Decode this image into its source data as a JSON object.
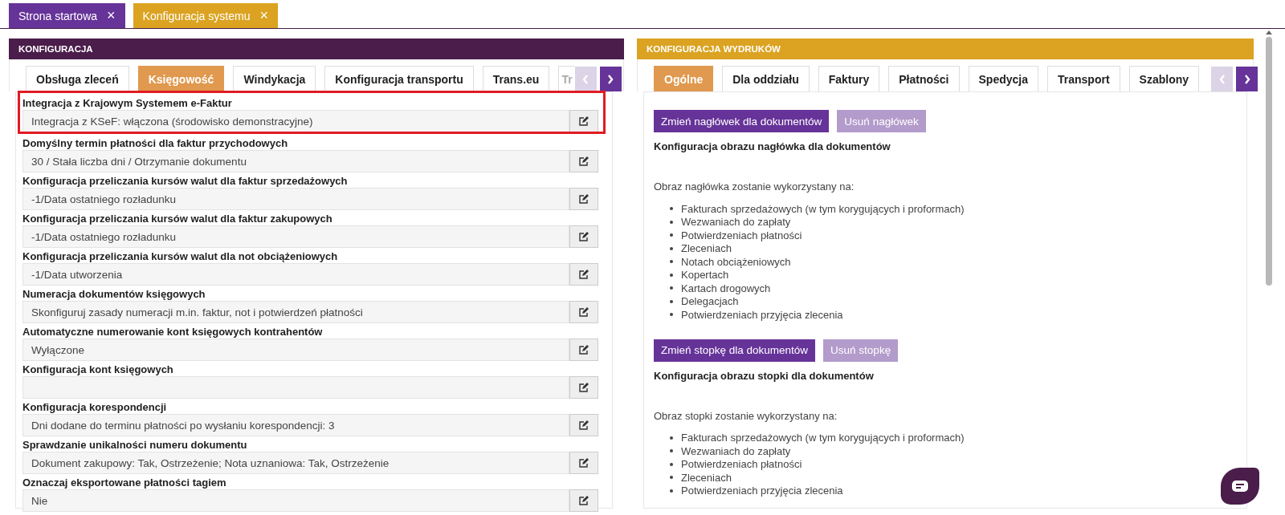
{
  "top_tabs": [
    {
      "label": "Strona startowa",
      "close": "×",
      "selected": false
    },
    {
      "label": "Konfiguracja systemu",
      "close": "×",
      "selected": true
    }
  ],
  "left_panel": {
    "title": "KONFIGURACJA",
    "tabs": [
      {
        "label": "Obsługa zleceń",
        "selected": false
      },
      {
        "label": "Księgowość",
        "selected": true
      },
      {
        "label": "Windykacja",
        "selected": false
      },
      {
        "label": "Konfiguracja transportu",
        "selected": false
      },
      {
        "label": "Trans.eu",
        "selected": false
      },
      {
        "label": "Tr",
        "selected": false
      }
    ],
    "prev_disabled": true,
    "next_disabled": false,
    "settings": [
      {
        "label": "Integracja z Krajowym Systemem e-Faktur",
        "value": "Integracja z KSeF: włączona (środowisko demonstracyjne)",
        "highlighted": true
      },
      {
        "label": "Domyślny termin płatności dla faktur przychodowych",
        "value": "30 / Stała liczba dni / Otrzymanie dokumentu",
        "highlighted": false
      },
      {
        "label": "Konfiguracja przeliczania kursów walut dla faktur sprzedażowych",
        "value": "-1/Data ostatniego rozładunku",
        "highlighted": false
      },
      {
        "label": "Konfiguracja przeliczania kursów walut dla faktur zakupowych",
        "value": "-1/Data ostatniego rozładunku",
        "highlighted": false
      },
      {
        "label": "Konfiguracja przeliczania kursów walut dla not obciążeniowych",
        "value": "-1/Data utworzenia",
        "highlighted": false
      },
      {
        "label": "Numeracja dokumentów księgowych",
        "value": "Skonfiguruj zasady numeracji m.in. faktur, not i potwierdzeń płatności",
        "highlighted": false
      },
      {
        "label": "Automatyczne numerowanie kont księgowych kontrahentów",
        "value": "Wyłączone",
        "highlighted": false
      },
      {
        "label": "Konfiguracja kont księgowych",
        "highlighted": false
      },
      {
        "label": "Konfiguracja korespondencji",
        "value": "Dni dodane do terminu płatności po wysłaniu korespondencji: 3",
        "highlighted": false
      },
      {
        "label": "Sprawdzanie unikalności numeru dokumentu",
        "value": "Dokument zakupowy: Tak, Ostrzeżenie; Nota uznaniowa: Tak, Ostrzeżenie",
        "highlighted": false
      },
      {
        "label": "Oznaczaj eksportowane płatności tagiem",
        "value": "Nie",
        "highlighted": false
      }
    ]
  },
  "right_panel": {
    "title": "KONFIGURACJA WYDRUKÓW",
    "tabs": [
      {
        "label": "Ogólne",
        "selected": true
      },
      {
        "label": "Dla oddziału",
        "selected": false
      },
      {
        "label": "Faktury",
        "selected": false
      },
      {
        "label": "Płatności",
        "selected": false
      },
      {
        "label": "Spedycja",
        "selected": false
      },
      {
        "label": "Transport",
        "selected": false
      },
      {
        "label": "Szablony",
        "selected": false
      }
    ],
    "prev_disabled": true,
    "next_disabled": false,
    "sections": [
      {
        "buttons": [
          {
            "label": "Zmień nagłówek dla dokumentów",
            "disabled": false
          },
          {
            "label": "Usuń nagłówek",
            "disabled": true
          }
        ],
        "heading": "Konfiguracja obrazu nagłówka dla dokumentów",
        "intro": "Obraz nagłówka zostanie wykorzystany na:",
        "items": [
          "Fakturach sprzedażowych (w tym korygujących i proformach)",
          "Wezwaniach do zapłaty",
          "Potwierdzeniach płatności",
          "Zleceniach",
          "Notach obciążeniowych",
          "Kopertach",
          "Kartach drogowych",
          "Delegacjach",
          "Potwierdzeniach przyjęcia zlecenia"
        ]
      },
      {
        "buttons": [
          {
            "label": "Zmień stopkę dla dokumentów",
            "disabled": false
          },
          {
            "label": "Usuń stopkę",
            "disabled": true
          }
        ],
        "heading": "Konfiguracja obrazu stopki dla dokumentów",
        "intro": "Obraz stopki zostanie wykorzystany na:",
        "items": [
          "Fakturach sprzedażowych (w tym korygujących i proformach)",
          "Wezwaniach do zapłaty",
          "Potwierdzeniach płatności",
          "Zleceniach",
          "Potwierdzeniach przyjęcia zlecenia"
        ]
      }
    ]
  }
}
